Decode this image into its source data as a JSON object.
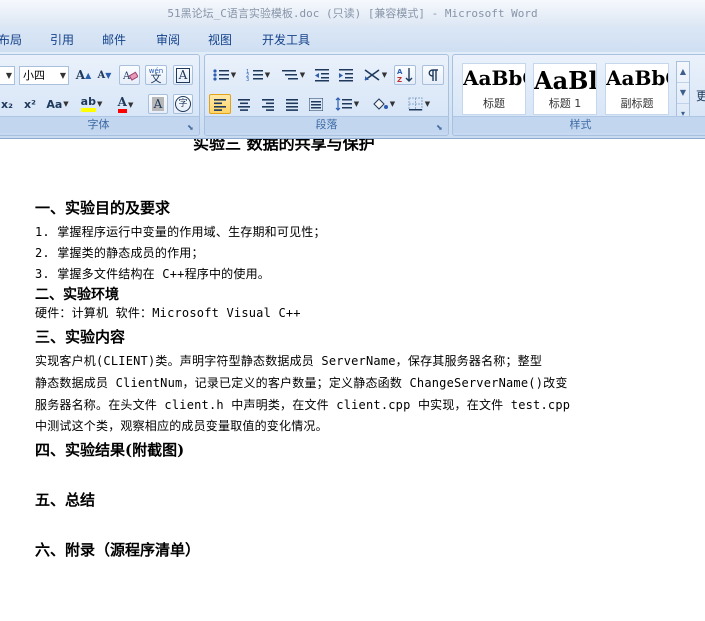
{
  "window": {
    "title": "51黑论坛_C语言实验模板.doc (只读) [兼容模式] - Microsoft Word"
  },
  "tabs": [
    "布局",
    "引用",
    "邮件",
    "审阅",
    "视图",
    "开发工具"
  ],
  "ribbon": {
    "font_group": {
      "label": "字体",
      "font_size": "小四",
      "grow_font": "A",
      "shrink_font": "A",
      "phonetic_label": "wén",
      "char_border": "A",
      "subscript": "x₂",
      "superscript": "x²",
      "change_case": "Aa",
      "highlight": "ab",
      "font_color": "A",
      "char_shading": "A",
      "enclose_char": "字"
    },
    "paragraph_group": {
      "label": "段落"
    },
    "styles_group": {
      "label": "样式",
      "styles": [
        {
          "sample": "AaBbC",
          "name": "标题"
        },
        {
          "sample": "AaBl",
          "name": "标题 1"
        },
        {
          "sample": "AaBbC",
          "name": "副标题"
        }
      ],
      "change_styles": "更"
    }
  },
  "document": {
    "title": "实验三  数据的共享与保护",
    "sections": [
      {
        "heading": "一、实验目的及要求"
      },
      {
        "heading": "二、实验环境"
      },
      {
        "heading": "三、实验内容"
      },
      {
        "heading": "四、实验结果(附截图)"
      },
      {
        "heading": "五、总结"
      },
      {
        "heading": "六、附录（源程序清单）"
      }
    ],
    "objectives": [
      "1. 掌握程序运行中变量的作用域、生存期和可见性；",
      "2. 掌握类的静态成员的作用；",
      "3. 掌握多文件结构在 C++程序中的使用。"
    ],
    "environment": "硬件：计算机   软件：Microsoft Visual C++",
    "content_lines": [
      "实现客户机(CLIENT)类。声明字符型静态数据成员 ServerName，保存其服务器名称；整型",
      "静态数据成员 ClientNum，记录已定义的客户数量；定义静态函数 ChangeServerName()改变",
      "服务器名称。在头文件 client.h 中声明类，在文件 client.cpp 中实现，在文件 test.cpp",
      "中测试这个类，观察相应的成员变量取值的变化情况。"
    ]
  }
}
